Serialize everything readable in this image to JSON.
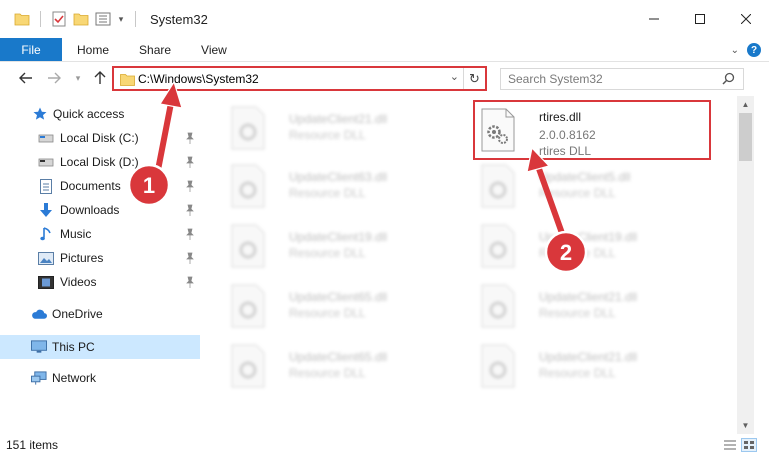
{
  "window": {
    "title": "System32",
    "minimize_icon": "minimize-icon",
    "maximize_icon": "maximize-icon",
    "close_icon": "close-icon"
  },
  "ribbon": {
    "tabs": [
      "File",
      "Home",
      "Share",
      "View"
    ],
    "help_label": "?"
  },
  "address": {
    "path": "C:\\Windows\\System32",
    "refresh_icon": "refresh-icon"
  },
  "search": {
    "placeholder": "Search System32"
  },
  "nav": {
    "items": [
      {
        "label": "Quick access",
        "icon": "star-icon"
      },
      {
        "label": "Local Disk (C:)",
        "icon": "drive-icon",
        "pinned": true
      },
      {
        "label": "Local Disk (D:)",
        "icon": "drive-icon",
        "pinned": true
      },
      {
        "label": "Documents",
        "icon": "documents-icon",
        "pinned": true
      },
      {
        "label": "Downloads",
        "icon": "download-arrow-icon",
        "pinned": true
      },
      {
        "label": "Music",
        "icon": "music-note-icon",
        "pinned": true
      },
      {
        "label": "Pictures",
        "icon": "pictures-icon",
        "pinned": true
      },
      {
        "label": "Videos",
        "icon": "videos-icon",
        "pinned": true
      },
      {
        "label": "OneDrive",
        "icon": "cloud-icon"
      },
      {
        "label": "This PC",
        "icon": "monitor-icon",
        "selected": true
      },
      {
        "label": "Network",
        "icon": "network-icon"
      }
    ]
  },
  "files": {
    "highlighted": {
      "name": "rtires.dll",
      "version": "2.0.0.8162",
      "description": "rtires DLL"
    },
    "left_column": [
      {
        "name": "UpdateClient21.dll",
        "type": "Resource DLL"
      },
      {
        "name": "UpdateClient63.dll",
        "type": "Resource DLL"
      },
      {
        "name": "UpdateClient19.dll",
        "type": "Resource DLL"
      },
      {
        "name": "UpdateClient65.dll",
        "type": "Resource DLL"
      },
      {
        "name": "UpdateClient65.dll",
        "type": "Resource DLL"
      }
    ],
    "right_column": [
      {
        "name": "UpdateClient5.dll",
        "type": "Resource DLL"
      },
      {
        "name": "UpdateClient19.dll",
        "type": "Resource DLL"
      },
      {
        "name": "UpdateClient21.dll",
        "type": "Resource DLL"
      },
      {
        "name": "UpdateClient21.dll",
        "type": "Resource DLL"
      }
    ]
  },
  "status": {
    "item_count": "151 items"
  },
  "annotations": {
    "badge1": "1",
    "badge2": "2",
    "color": "#d9373b"
  }
}
